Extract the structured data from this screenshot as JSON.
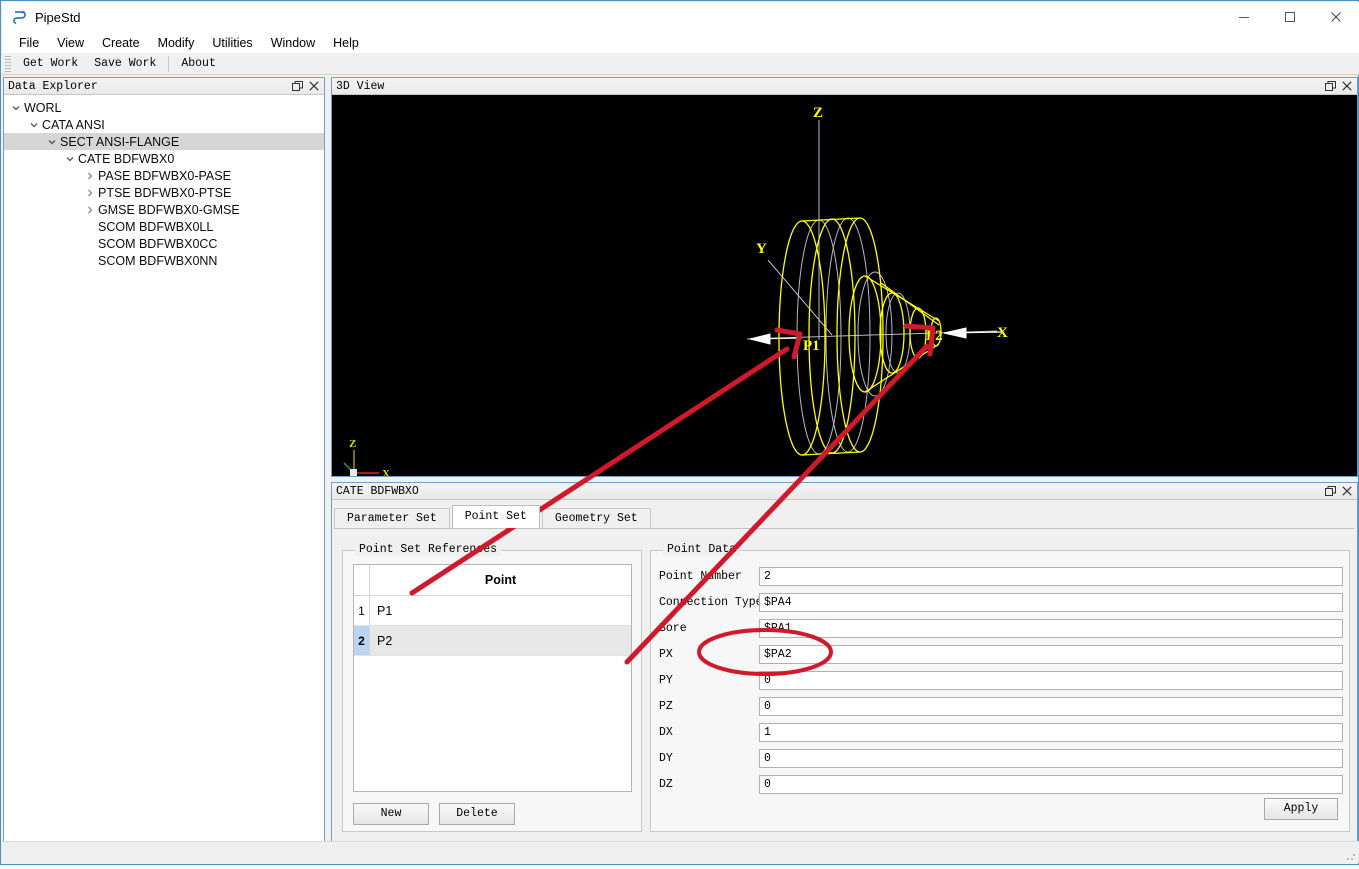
{
  "window": {
    "title": "PipeStd",
    "app_icon": "pipe-logo-icon",
    "minimize": "minimize-icon",
    "maximize": "maximize-icon",
    "close": "close-icon"
  },
  "menu": {
    "items": [
      {
        "label": "File"
      },
      {
        "label": "View"
      },
      {
        "label": "Create"
      },
      {
        "label": "Modify"
      },
      {
        "label": "Utilities"
      },
      {
        "label": "Window"
      },
      {
        "label": "Help"
      }
    ]
  },
  "toolbar": {
    "buttons": [
      {
        "label": "Get Work"
      },
      {
        "label": "Save Work"
      },
      {
        "label": "About"
      }
    ]
  },
  "data_explorer": {
    "caption": "Data Explorer",
    "float_icon": "float-window-icon",
    "close_icon": "close-icon",
    "tree": [
      {
        "label": "WORL",
        "depth": 0,
        "arrow": "chevron-down-icon",
        "selected": false
      },
      {
        "label": "CATA ANSI",
        "depth": 1,
        "arrow": "chevron-down-icon",
        "selected": false
      },
      {
        "label": "SECT ANSI-FLANGE",
        "depth": 2,
        "arrow": "chevron-down-icon",
        "selected": true
      },
      {
        "label": "CATE BDFWBX0",
        "depth": 3,
        "arrow": "chevron-down-icon",
        "selected": false
      },
      {
        "label": "PASE BDFWBX0-PASE",
        "depth": 4,
        "arrow": "chevron-right-icon",
        "selected": false
      },
      {
        "label": "PTSE BDFWBX0-PTSE",
        "depth": 4,
        "arrow": "chevron-right-icon",
        "selected": false
      },
      {
        "label": "GMSE BDFWBX0-GMSE",
        "depth": 4,
        "arrow": "chevron-right-icon",
        "selected": false
      },
      {
        "label": "SCOM BDFWBX0LL",
        "depth": 4,
        "arrow": "none",
        "selected": false
      },
      {
        "label": "SCOM BDFWBX0CC",
        "depth": 4,
        "arrow": "none",
        "selected": false
      },
      {
        "label": "SCOM BDFWBX0NN",
        "depth": 4,
        "arrow": "none",
        "selected": false
      }
    ]
  },
  "view3d": {
    "caption": "3D View",
    "float_icon": "float-window-icon",
    "close_icon": "close-icon",
    "background_color": "#000000",
    "geometry_color": "#ffff00",
    "axis_color": "#c8c8dc",
    "labels": {
      "axis_z": "Z",
      "axis_y": "Y",
      "axis_x": "X",
      "point_1": "P1",
      "point_2": "P2",
      "triad_z": "Z",
      "triad_x": "X"
    }
  },
  "cate_panel": {
    "caption": "CATE BDFWBXO",
    "float_icon": "float-window-icon",
    "close_icon": "close-icon",
    "tabs": [
      {
        "label": "Parameter Set",
        "active": false
      },
      {
        "label": "Point Set",
        "active": true
      },
      {
        "label": "Geometry Set",
        "active": false
      }
    ],
    "point_set_references": {
      "group_title": "Point Set References",
      "column_header": "Point",
      "rows": [
        {
          "number": "1",
          "point": "P1",
          "selected": false
        },
        {
          "number": "2",
          "point": "P2",
          "selected": true
        }
      ],
      "new_button": "New",
      "delete_button": "Delete"
    },
    "point_data": {
      "group_title": "Point Data",
      "fields": [
        {
          "label": "Point Number",
          "value": "2"
        },
        {
          "label": "Connection Type",
          "value": "$PA4"
        },
        {
          "label": "Bore",
          "value": "$PA1"
        },
        {
          "label": "PX",
          "value": "$PA2"
        },
        {
          "label": "PY",
          "value": "0"
        },
        {
          "label": "PZ",
          "value": "0"
        },
        {
          "label": "DX",
          "value": "1"
        },
        {
          "label": "DY",
          "value": "0"
        },
        {
          "label": "DZ",
          "value": "0"
        }
      ],
      "apply_button": "Apply"
    }
  },
  "annotations": {
    "highlight_color": "#d0192b",
    "arrow_1": "red-arrow-to-p1",
    "arrow_2": "red-arrow-to-p2",
    "ellipse": "red-ellipse-around-px-field"
  },
  "status_bar": {
    "text": ""
  }
}
